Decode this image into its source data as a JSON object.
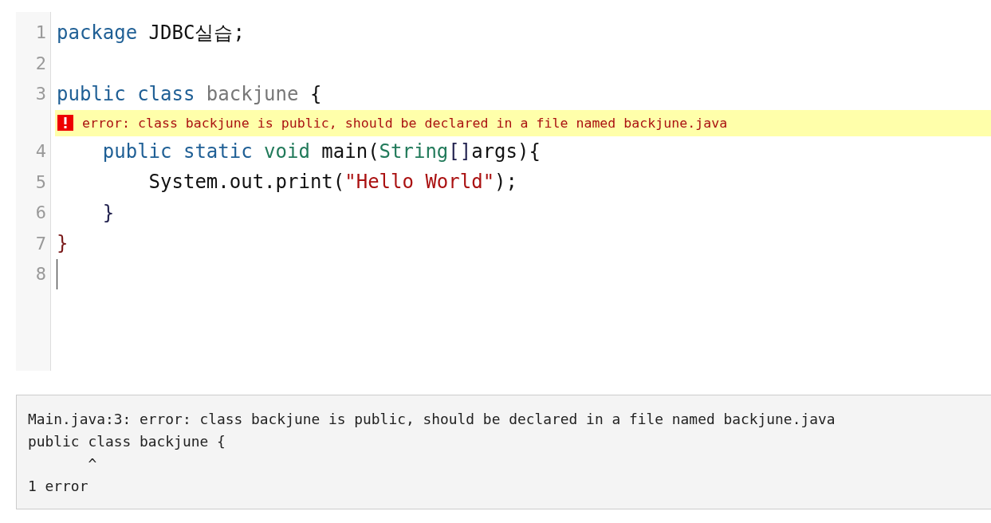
{
  "editor": {
    "lines": [
      {
        "number": "1",
        "cursor": false,
        "tokens": [
          {
            "text": "package",
            "kind": "keyword"
          },
          {
            "text": " JDBC실습;",
            "kind": "plain"
          }
        ]
      },
      {
        "number": "2",
        "cursor": false
      },
      {
        "number": "3",
        "cursor": false,
        "tokens": [
          {
            "text": "public class",
            "kind": "keyword"
          },
          {
            "text": " backjune",
            "kind": "definition"
          },
          {
            "text": " {",
            "kind": "plain"
          }
        ],
        "error": "error: class backjune is public, should be declared in a file named backjune.java"
      },
      {
        "number": "4",
        "cursor": false,
        "tokens": [
          {
            "text": "    public static",
            "kind": "keyword"
          },
          {
            "text": " void",
            "kind": "type"
          },
          {
            "text": " main(",
            "kind": "plain"
          },
          {
            "text": "String",
            "kind": "type"
          },
          {
            "text": "[]",
            "kind": "bracket"
          },
          {
            "text": "args){",
            "kind": "plain"
          }
        ]
      },
      {
        "number": "5",
        "cursor": false,
        "tokens": [
          {
            "text": "        System.out.print(",
            "kind": "plain"
          },
          {
            "text": "\"Hello World\"",
            "kind": "string"
          },
          {
            "text": ");",
            "kind": "plain"
          }
        ]
      },
      {
        "number": "6",
        "cursor": false,
        "tokens": [
          {
            "text": "    }",
            "kind": "bracket"
          }
        ]
      },
      {
        "number": "7",
        "cursor": false,
        "tokens": [
          {
            "text": "}",
            "kind": "outer-bracket"
          }
        ]
      },
      {
        "number": "8",
        "cursor": true
      }
    ]
  },
  "output": {
    "lines": [
      "Main.java:3: error: class backjune is public, should be declared in a file named backjune.java",
      "public class backjune {",
      "       ^",
      "1 error"
    ]
  }
}
